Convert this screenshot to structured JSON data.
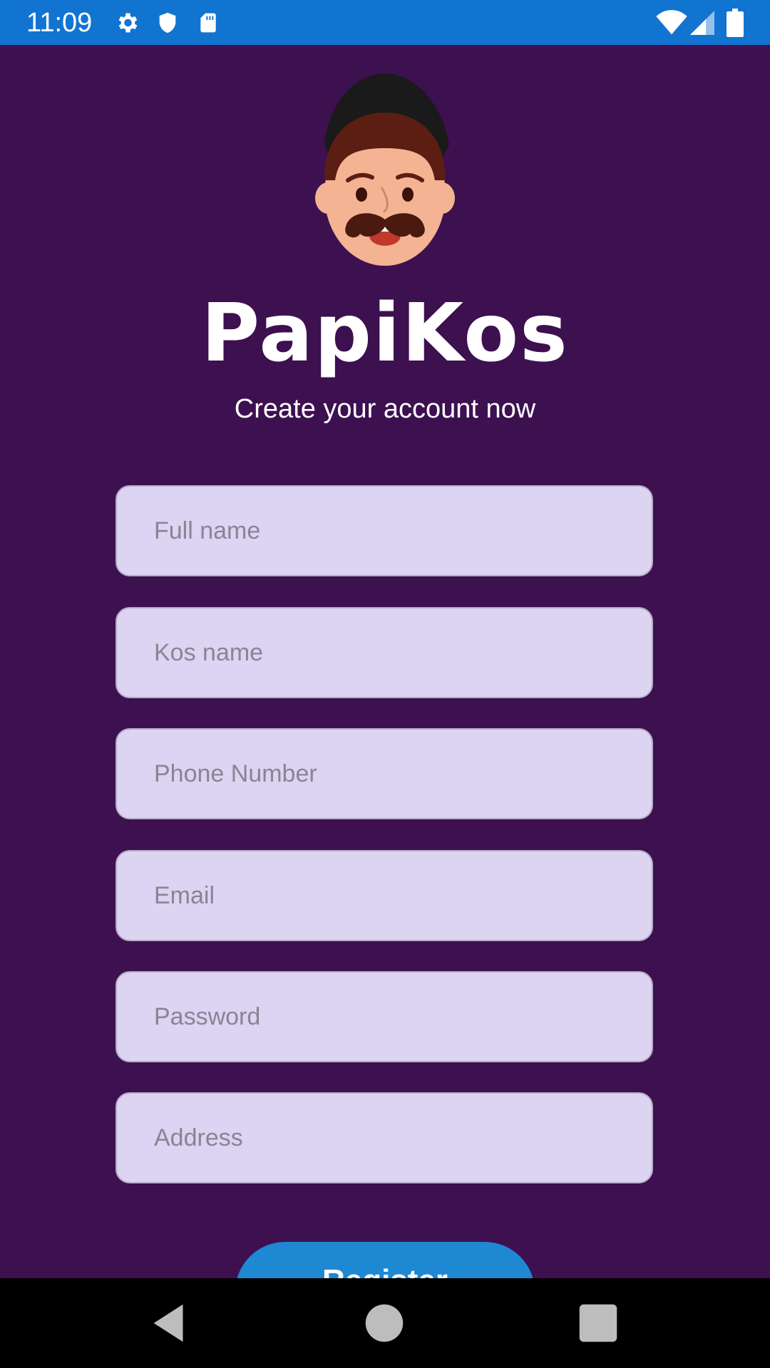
{
  "status_bar": {
    "time": "11:09",
    "left_icons": [
      "gear-icon",
      "shield-icon",
      "sd-card-icon"
    ],
    "right_icons": [
      "wifi-icon",
      "cell-signal-icon",
      "battery-icon"
    ],
    "color": "#1274d1"
  },
  "logo": {
    "icon": "mustache-man-avatar-icon"
  },
  "app_name": "PapiKos",
  "subtitle": "Create your account now",
  "form": {
    "full_name": {
      "placeholder": "Full name",
      "value": ""
    },
    "kos_name": {
      "placeholder": "Kos name",
      "value": ""
    },
    "phone_number": {
      "placeholder": "Phone Number",
      "value": ""
    },
    "email": {
      "placeholder": "Email",
      "value": ""
    },
    "password": {
      "placeholder": "Password",
      "value": ""
    },
    "address": {
      "placeholder": "Address",
      "value": ""
    }
  },
  "register_button": {
    "label": "Register",
    "color": "#1e88d3"
  },
  "nav_bar": {
    "icons": [
      "back-icon",
      "home-icon",
      "recents-icon"
    ]
  },
  "colors": {
    "background": "#3d1050",
    "field_bg": "#ddd3f2"
  }
}
